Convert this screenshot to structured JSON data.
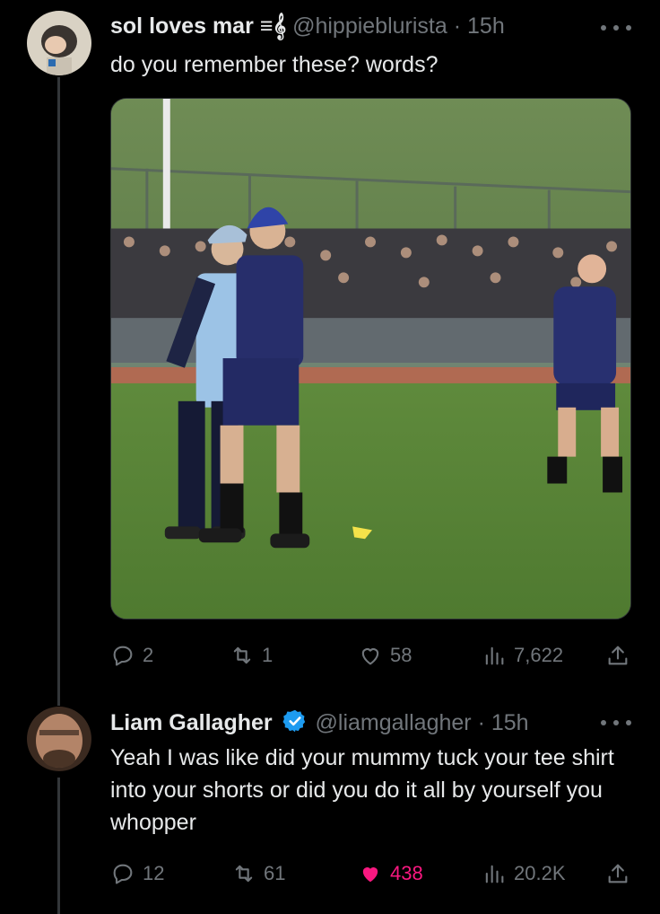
{
  "tweets": [
    {
      "display_name": "sol loves mar ≡𝄞",
      "handle": "@hippieblurista",
      "sep": "·",
      "time": "15h",
      "text": "do you remember these? words?",
      "has_image": true,
      "stats": {
        "replies": "2",
        "reposts": "1",
        "likes": "58",
        "views": "7,622"
      },
      "liked": false
    },
    {
      "display_name": "Liam Gallagher",
      "verified": true,
      "handle": "@liamgallagher",
      "sep": "·",
      "time": "15h",
      "text": "Yeah I was like did your mummy tuck your tee shirt into your shorts or did you do it all by yourself you whopper",
      "stats": {
        "replies": "12",
        "reposts": "61",
        "likes": "438",
        "views": "20.2K"
      },
      "liked": true
    }
  ],
  "icons": [
    "reply-icon",
    "repost-icon",
    "like-icon",
    "views-icon",
    "share-icon",
    "more-icon",
    "verified-badge-icon"
  ],
  "colors": {
    "background": "#000000",
    "text": "#e7e9ea",
    "muted": "#71767b",
    "like_active": "#f91880",
    "verified": "#1d9bf0"
  }
}
